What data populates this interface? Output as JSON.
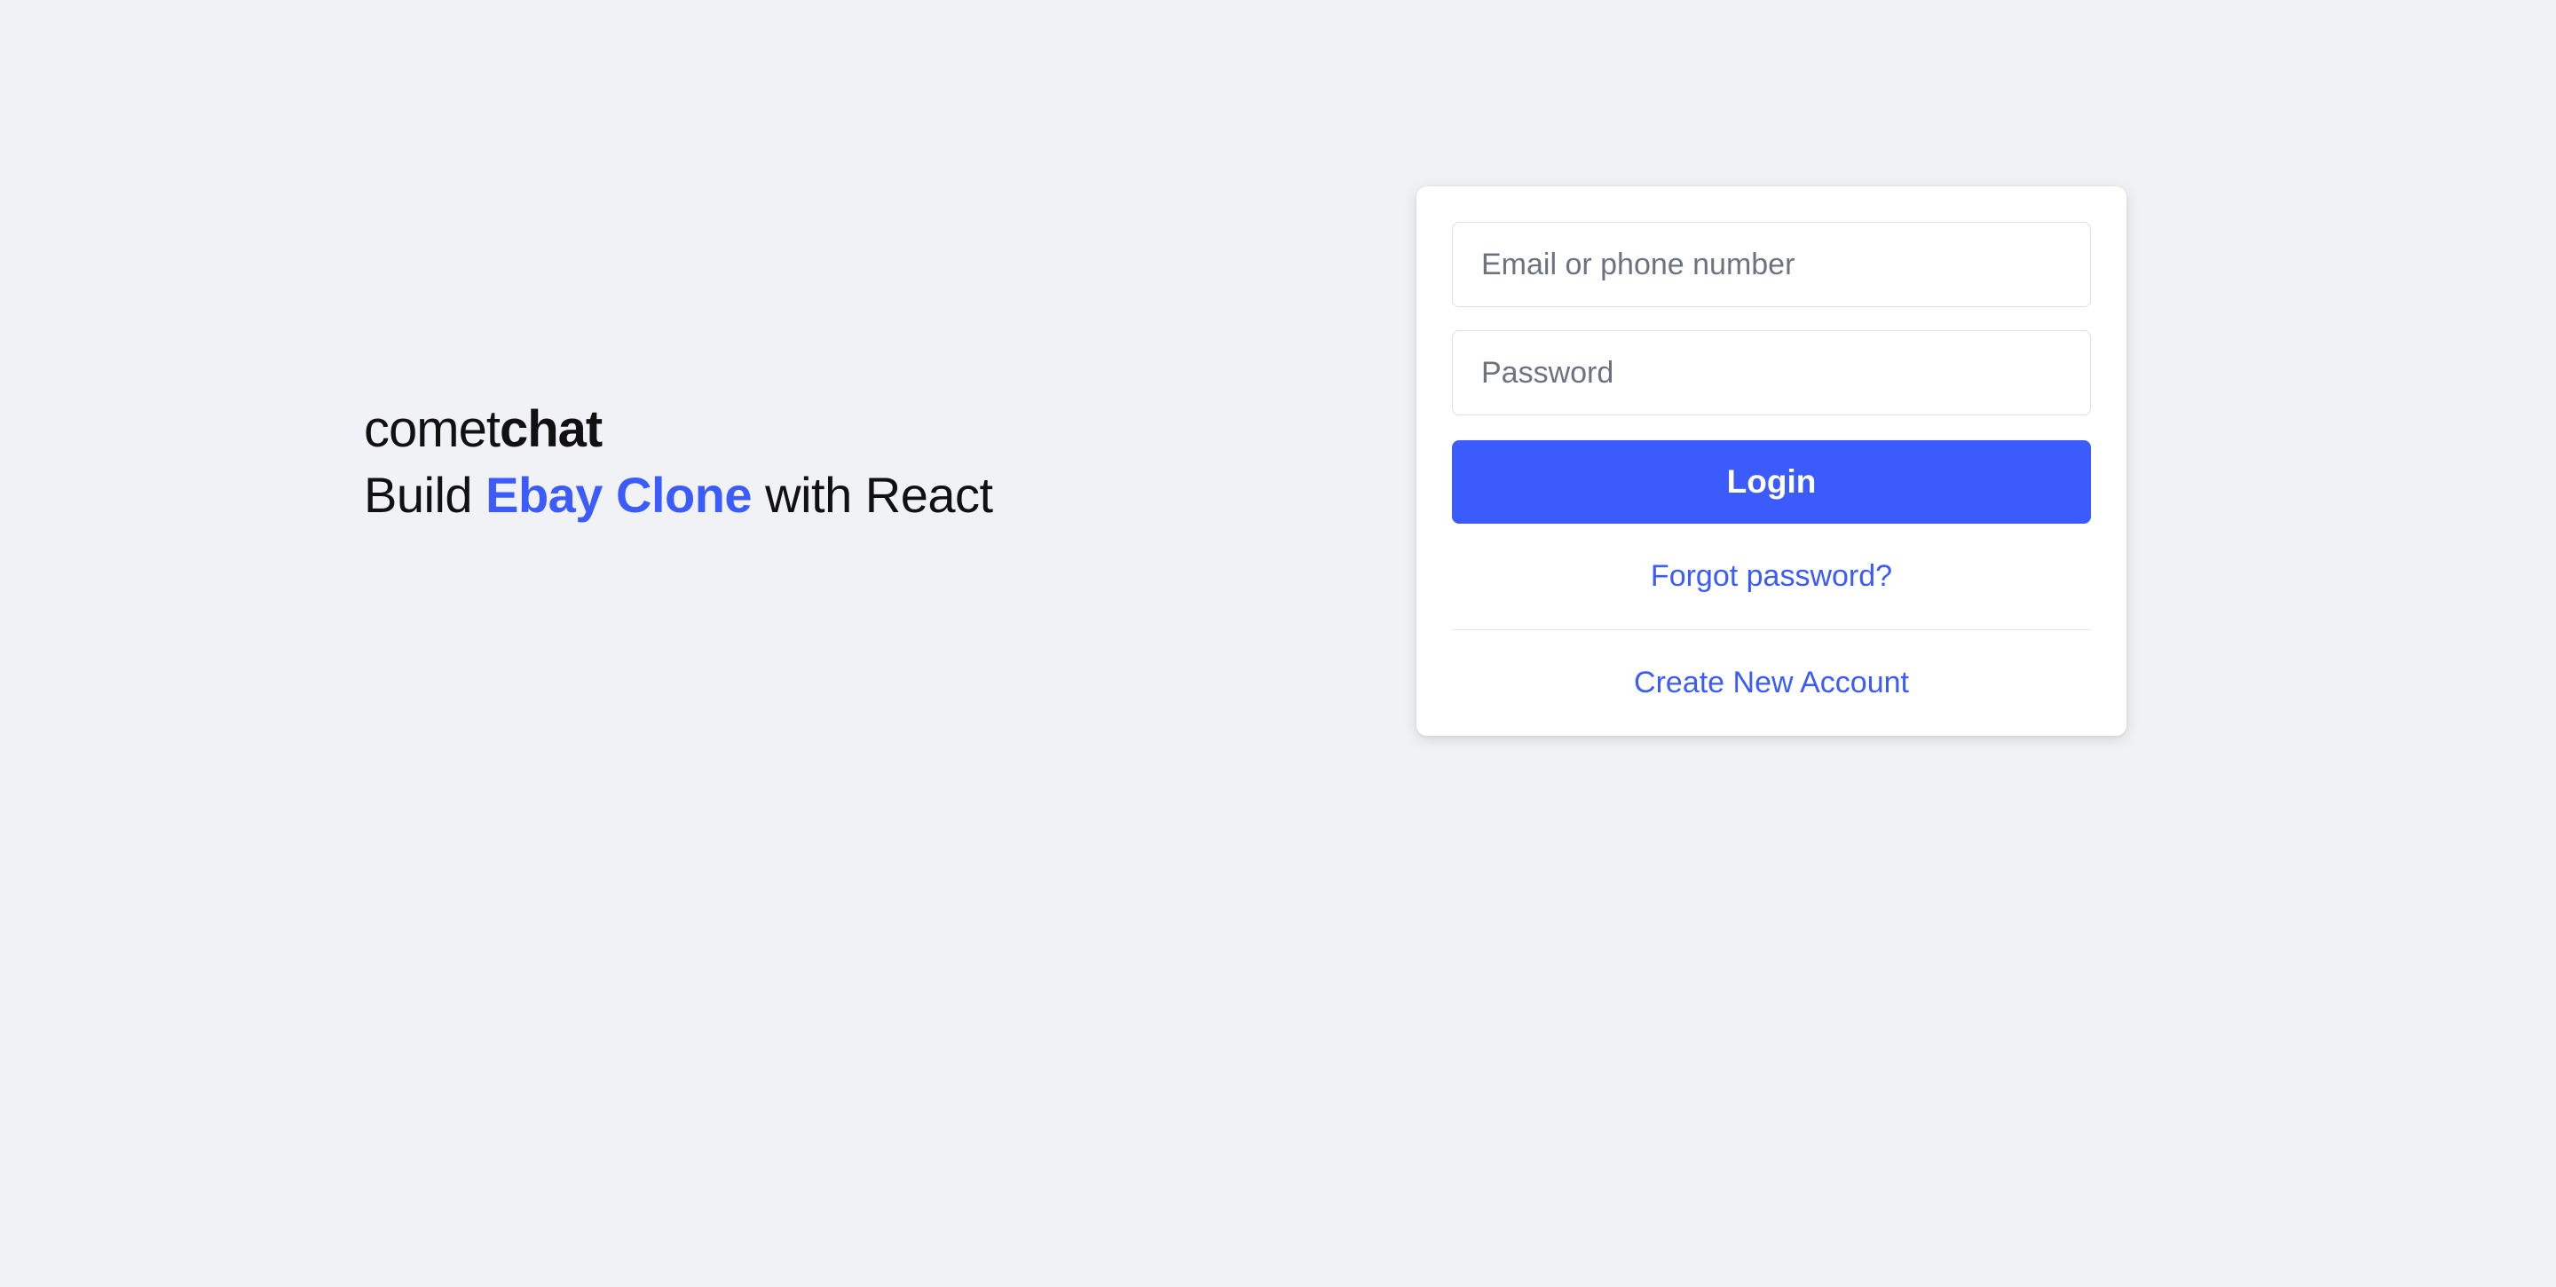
{
  "brand": {
    "logo_part1": "comet",
    "logo_part2": "chat",
    "tagline_pre": "Build ",
    "tagline_highlight": "Ebay Clone",
    "tagline_post": " with React"
  },
  "login_form": {
    "email_placeholder": "Email or phone number",
    "password_placeholder": "Password",
    "login_button_label": "Login",
    "forgot_password_label": "Forgot password?",
    "create_account_label": "Create New Account"
  },
  "colors": {
    "accent": "#3b5bfd",
    "background": "#f0f2f5",
    "card_bg": "#ffffff",
    "border": "#dde0e4"
  }
}
